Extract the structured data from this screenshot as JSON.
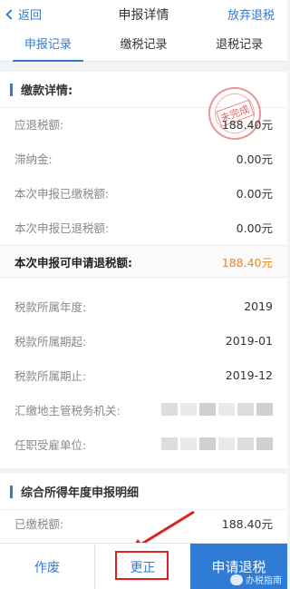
{
  "nav": {
    "back_label": "返回",
    "title": "申报详情",
    "abandon_label": "放弃退税"
  },
  "tabs": [
    {
      "label": "申报记录",
      "active": true
    },
    {
      "label": "缴税记录",
      "active": false
    },
    {
      "label": "退税记录",
      "active": false
    }
  ],
  "payment": {
    "section_title": "缴款详情:",
    "stamp_text": "未完成",
    "rows": [
      {
        "label": "应退税额:",
        "value": "188.40元"
      },
      {
        "label": "滞纳金:",
        "value": "0.00元"
      },
      {
        "label": "本次申报已缴税额:",
        "value": "0.00元"
      },
      {
        "label": "本次申报已退税额:",
        "value": "0.00元"
      }
    ],
    "highlight": {
      "label": "本次申报可申请退税额:",
      "value": "188.40元"
    },
    "info_rows": [
      {
        "label": "税款所属年度:",
        "value": "2019"
      },
      {
        "label": "税款所属期起:",
        "value": "2019-01"
      },
      {
        "label": "税款所属期止:",
        "value": "2019-12"
      },
      {
        "label": "汇缴地主管税务机关:",
        "value": ""
      },
      {
        "label": "任职受雇单位:",
        "value": ""
      }
    ]
  },
  "annual": {
    "section_title": "综合所得年度申报明细",
    "rows": [
      {
        "label": "已缴税额:",
        "value": "188.40元"
      }
    ]
  },
  "bottom": {
    "void_label": "作废",
    "correct_label": "更正",
    "apply_label": "申请退税",
    "watermark": "办税指南"
  },
  "colors": {
    "accent": "#2f7bd6",
    "highlight": "#e8862b",
    "annotation": "#e02020"
  }
}
